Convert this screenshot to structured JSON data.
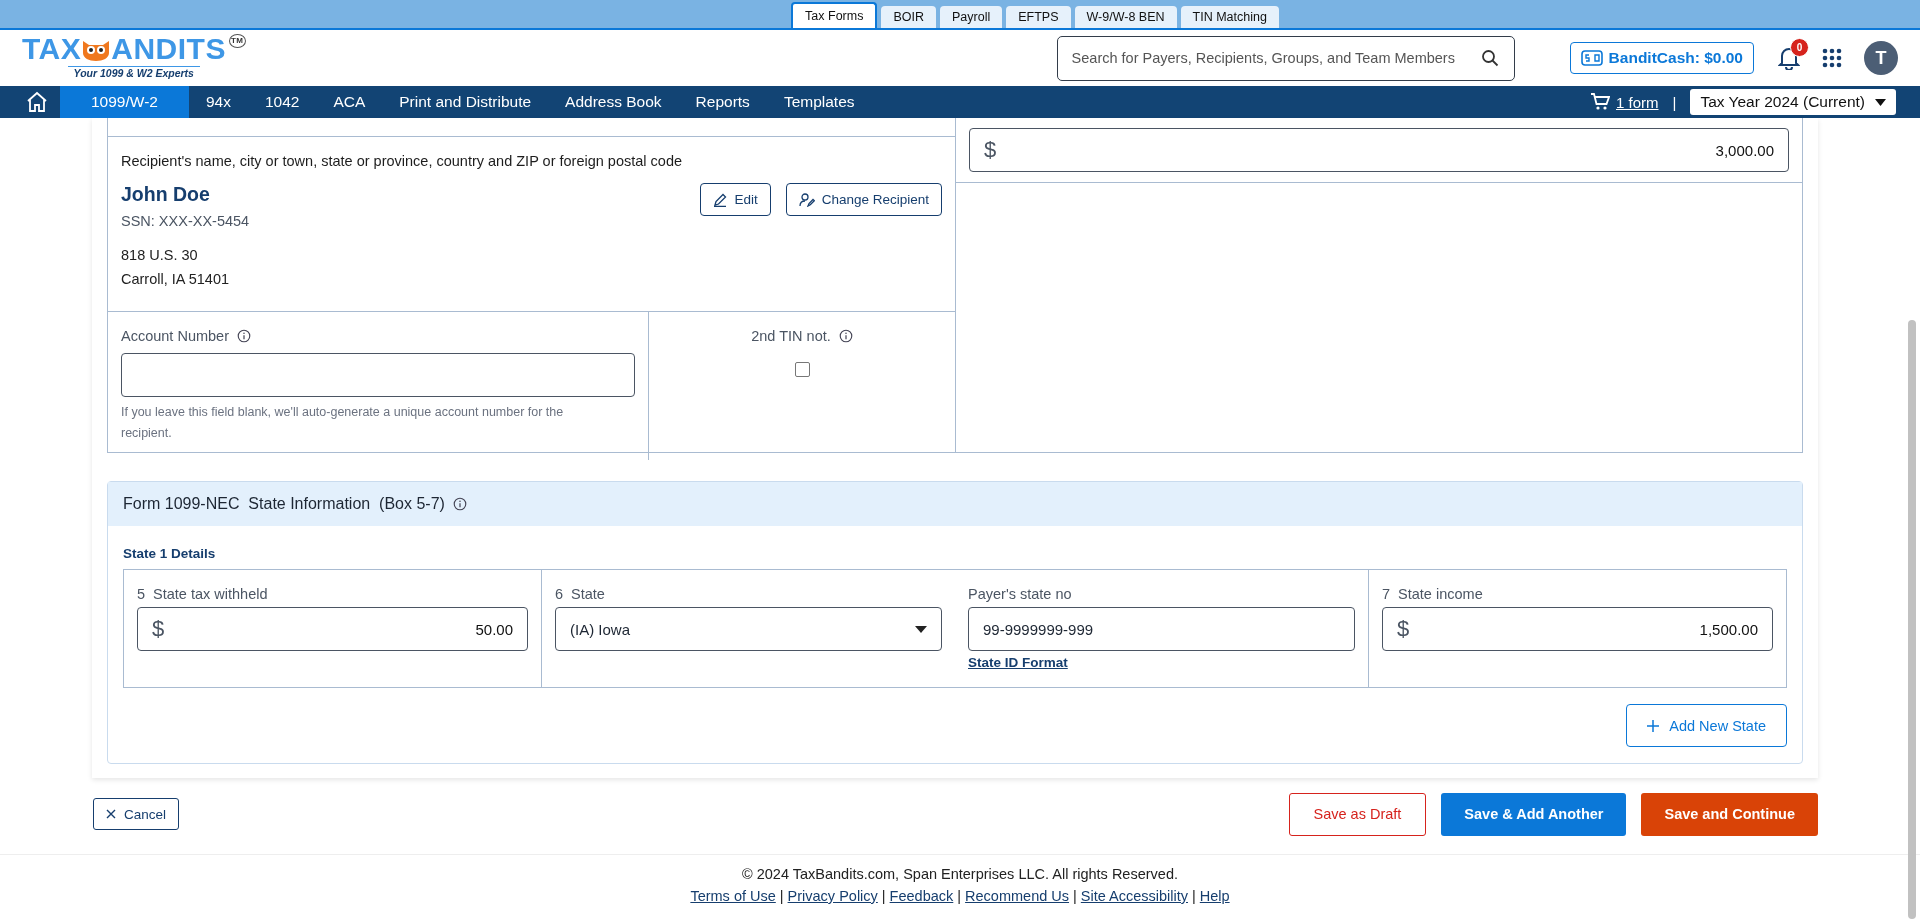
{
  "top_tabs": [
    {
      "label": "Tax Forms",
      "selected": true
    },
    {
      "label": "BOIR",
      "selected": false
    },
    {
      "label": "Payroll",
      "selected": false
    },
    {
      "label": "EFTPS",
      "selected": false
    },
    {
      "label": "W-9/W-8 BEN",
      "selected": false
    },
    {
      "label": "TIN Matching",
      "selected": false
    }
  ],
  "header": {
    "logo": {
      "left": "TAX",
      "right": "ANDITS",
      "tm": "TM",
      "tagline": "Your 1099 & W2 Experts"
    },
    "search": {
      "placeholder": "Search for Payers, Recipients, Groups, and Team Members"
    },
    "bandit_cash": "BanditCash: $0.00",
    "notifications": "0",
    "avatar": "T"
  },
  "nav": {
    "items": [
      {
        "label": "1099/W-2",
        "selected": true
      },
      {
        "label": "94x",
        "selected": false
      },
      {
        "label": "1042",
        "selected": false
      },
      {
        "label": "ACA",
        "selected": false
      },
      {
        "label": "Print and Distribute",
        "selected": false
      },
      {
        "label": "Address Book",
        "selected": false
      },
      {
        "label": "Reports",
        "selected": false
      },
      {
        "label": "Templates",
        "selected": false
      }
    ],
    "cart": "1 form",
    "separator": "|",
    "tax_year": "Tax Year 2024 (Current)"
  },
  "recipient": {
    "heading": "Recipient's name, city or town, state or province, country and ZIP or foreign postal code",
    "name": "John Doe",
    "ssn": "SSN: XXX-XX-5454",
    "address": [
      "818 U.S. 30",
      "Carroll, IA 51401"
    ],
    "edit": "Edit",
    "change": "Change Recipient"
  },
  "account": {
    "label": "Account Number",
    "hint": "If you leave this field blank, we'll auto-generate a unique account number for the recipient."
  },
  "second_tin": {
    "label": "2nd TIN not.",
    "checked": false
  },
  "amount": {
    "currency": "$",
    "value": "3,000.00"
  },
  "state_info": {
    "title": "Form 1099-NEC  State Information  (Box 5-7)",
    "subtitle": "State 1 Details",
    "tax_withheld": {
      "number": "5",
      "label": "State tax withheld",
      "currency": "$",
      "value": "50.00"
    },
    "state": {
      "number": "6",
      "label": "State",
      "value": "(IA) Iowa"
    },
    "payer_state_no": {
      "label": "Payer's state no",
      "value": "99-9999999-999",
      "link": "State ID Format"
    },
    "income": {
      "number": "7",
      "label": "State income",
      "currency": "$",
      "value": "1,500.00"
    },
    "add": "Add New State"
  },
  "actions": [
    {
      "kind": "cancel",
      "label": "Cancel"
    },
    {
      "kind": "draft",
      "label": "Save as Draft"
    },
    {
      "kind": "primary",
      "label": "Save & Add Another"
    },
    {
      "kind": "accent",
      "label": "Save and Continue"
    }
  ],
  "footer": {
    "copyright": "© 2024 TaxBandits.com, Span Enterprises LLC. All rights Reserved.",
    "links": [
      {
        "kind": "link",
        "text": "Terms of Use"
      },
      {
        "kind": "separator",
        "text": "|"
      },
      {
        "kind": "link",
        "text": "Privacy Policy"
      },
      {
        "kind": "separator",
        "text": "|"
      },
      {
        "kind": "link",
        "text": "Feedback"
      },
      {
        "kind": "separator",
        "text": "|"
      },
      {
        "kind": "link",
        "text": "Recommend Us"
      },
      {
        "kind": "separator",
        "text": "|"
      },
      {
        "kind": "link",
        "text": "Site Accessibility"
      },
      {
        "kind": "separator",
        "text": "|"
      },
      {
        "kind": "link",
        "text": "Help"
      }
    ]
  }
}
